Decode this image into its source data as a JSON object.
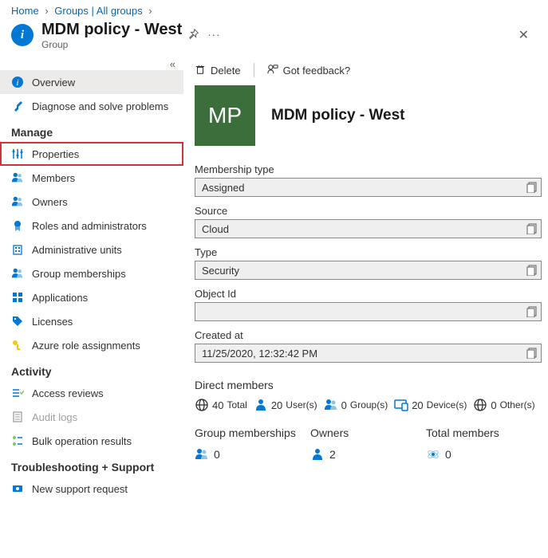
{
  "breadcrumb": {
    "home": "Home",
    "groups": "Groups | All groups"
  },
  "header": {
    "title": "MDM policy - West",
    "subtitle": "Group"
  },
  "sidebar": {
    "overview": "Overview",
    "diagnose": "Diagnose and solve problems",
    "manage_header": "Manage",
    "properties": "Properties",
    "members": "Members",
    "owners": "Owners",
    "roles": "Roles and administrators",
    "admin_units": "Administrative units",
    "group_memberships": "Group memberships",
    "applications": "Applications",
    "licenses": "Licenses",
    "azure_role": "Azure role assignments",
    "activity_header": "Activity",
    "access_reviews": "Access reviews",
    "audit_logs": "Audit logs",
    "bulk_results": "Bulk operation results",
    "troubleshoot_header": "Troubleshooting + Support",
    "support": "New support request"
  },
  "toolbar": {
    "delete": "Delete",
    "feedback": "Got feedback?"
  },
  "avatar_initials": "MP",
  "page_title": "MDM policy - West",
  "fields": {
    "membership_type": {
      "label": "Membership type",
      "value": "Assigned"
    },
    "source": {
      "label": "Source",
      "value": "Cloud"
    },
    "type": {
      "label": "Type",
      "value": "Security"
    },
    "object_id": {
      "label": "Object Id",
      "value": ""
    },
    "created_at": {
      "label": "Created at",
      "value": "11/25/2020, 12:32:42 PM"
    }
  },
  "direct_members": {
    "header": "Direct members",
    "total": {
      "count": "40",
      "label": "Total"
    },
    "users": {
      "count": "20",
      "label": "User(s)"
    },
    "groups": {
      "count": "0",
      "label": "Group(s)"
    },
    "devices": {
      "count": "20",
      "label": "Device(s)"
    },
    "others": {
      "count": "0",
      "label": "Other(s)"
    }
  },
  "summary": {
    "group_memberships": {
      "label": "Group memberships",
      "value": "0"
    },
    "owners": {
      "label": "Owners",
      "value": "2"
    },
    "total_members": {
      "label": "Total members",
      "value": "0"
    }
  }
}
